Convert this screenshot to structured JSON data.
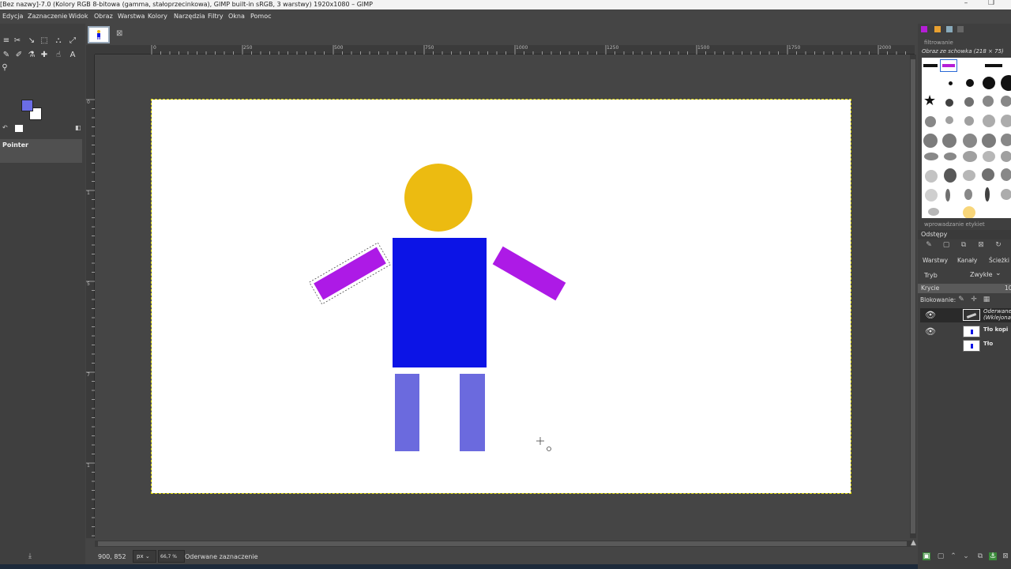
{
  "window": {
    "title": "[Bez nazwy]-7.0 (Kolory RGB 8-bitowa (gamma, stałoprzecinkowa), GIMP built-in sRGB, 3 warstwy) 1920x1080 – GIMP",
    "minimize": "–",
    "restore": "❐"
  },
  "menu": [
    "Edycja",
    "Zaznaczenie",
    "Widok",
    "Obraz",
    "Warstwa",
    "Kolory",
    "Narzędzia",
    "Filtry",
    "Okna",
    "Pomoc"
  ],
  "toolbox": {
    "tool_options_title": "Pointer",
    "fg_color": "#6b6de6",
    "bg_color": "#ffffff"
  },
  "image_tab": {
    "close": "⊠"
  },
  "rulers": {
    "h_labels": [
      "0",
      "250",
      "500",
      "750",
      "1000",
      "1250",
      "1500",
      "1750",
      "2000"
    ],
    "v_labels": [
      "0",
      "1",
      "5",
      "7",
      "1",
      "1"
    ]
  },
  "figure": {
    "head_color": "#ecbb11",
    "body_color": "#0c14e6",
    "arm_color": "#ad1ae6",
    "leg_color": "#6b6ade"
  },
  "statusbar": {
    "coords": "900, 852",
    "unit": "px",
    "zoom": "66,7 %",
    "message": "Oderwane zaznaczenie"
  },
  "dock": {
    "filter_placeholder": "filtrowanie",
    "brush_title": "Obraz ze schowka (218 × 75)",
    "tag_placeholder": "wprowadzanie etykiet",
    "spacing_label": "Odstępy",
    "tabs": [
      "Warstwy",
      "Kanały",
      "Ścieżki"
    ],
    "mode_label": "Tryb",
    "mode_value": "Zwykłe",
    "opacity_label": "Krycie",
    "opacity_value": "10",
    "lock_label": "Blokowanie:",
    "layers": [
      {
        "name": "Oderwane (Wklejona",
        "visible": true
      },
      {
        "name": "Tło kopi",
        "visible": true
      },
      {
        "name": "Tło",
        "visible": false
      }
    ]
  }
}
